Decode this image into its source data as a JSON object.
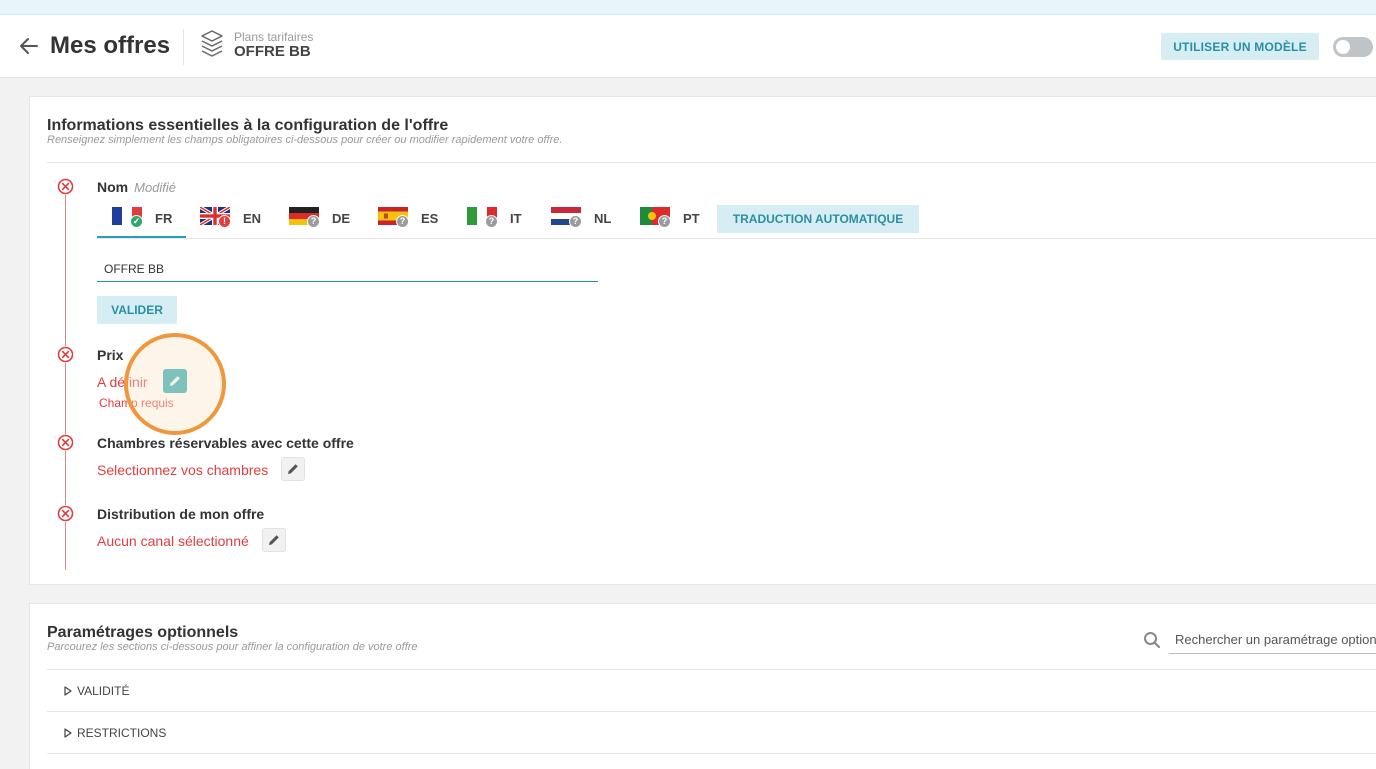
{
  "header": {
    "title": "Mes offres",
    "breadcrumb_small": "Plans tarifaires",
    "breadcrumb_main": "OFFRE BB",
    "model_button": "UTILISER UN MODÈLE"
  },
  "essentials": {
    "title": "Informations essentielles à la configuration de l'offre",
    "subtitle": "Renseignez simplement les champs obligatoires ci-dessous pour créer ou modifier rapidement votre offre.",
    "name": {
      "label": "Nom",
      "modified": "Modifié",
      "languages": [
        {
          "code": "FR",
          "status": "ok",
          "active": true
        },
        {
          "code": "EN",
          "status": "error",
          "active": false
        },
        {
          "code": "DE",
          "status": "unknown",
          "active": false
        },
        {
          "code": "ES",
          "status": "unknown",
          "active": false
        },
        {
          "code": "IT",
          "status": "unknown",
          "active": false
        },
        {
          "code": "NL",
          "status": "unknown",
          "active": false
        },
        {
          "code": "PT",
          "status": "unknown",
          "active": false
        }
      ],
      "auto_translate": "TRADUCTION AUTOMATIQUE",
      "value": "OFFRE BB",
      "validate": "VALIDER"
    },
    "price": {
      "label": "Prix",
      "link": "A définir",
      "required": "Champ requis"
    },
    "rooms": {
      "label": "Chambres réservables avec cette offre",
      "link": "Selectionnez vos chambres"
    },
    "distribution": {
      "label": "Distribution de mon offre",
      "link": "Aucun canal sélectionné"
    }
  },
  "optional": {
    "title": "Paramétrages optionnels",
    "subtitle": "Parcourez les sections ci-dessous pour affiner la configuration de votre offre",
    "search_placeholder": "Rechercher un paramétrage optionnel",
    "sections": [
      "VALIDITÉ",
      "RESTRICTIONS"
    ]
  },
  "colors": {
    "accent": "#2a8fa3",
    "accent_bg": "#d6eef3",
    "error": "#e23d3d",
    "highlight": "#f0963c"
  }
}
